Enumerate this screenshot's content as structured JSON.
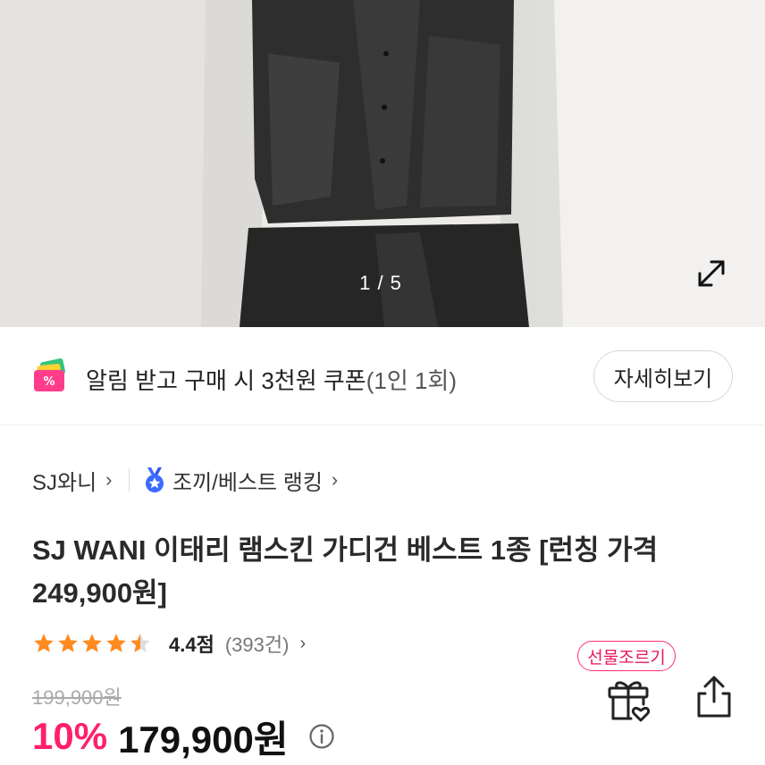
{
  "hero": {
    "counter": "1 / 5",
    "expand_icon": "expand-arrows-icon"
  },
  "coupon": {
    "icon": "coupon-ticket-icon",
    "text_main": "알림 받고 구매 시 3천원 쿠폰",
    "text_sub": "(1인 1회)",
    "detail_label": "자세히보기"
  },
  "breadcrumb": {
    "brand": "SJ와니",
    "ranking_badge_icon": "ranking-medal-icon",
    "ranking": "조끼/베스트 랭킹"
  },
  "product": {
    "title": "SJ WANI 이태리 램스킨 가디건 베스트 1종 [런칭 가격 249,900원]",
    "rating": 4.4,
    "score_label": "4.4점",
    "review_count": "(393건)",
    "original_price": "199,900원",
    "discount": "10%",
    "price": "179,900원"
  },
  "actions": {
    "gift_label": "선물조르기",
    "gift_icon": "gift-heart-icon",
    "share_icon": "share-icon",
    "info_icon": "info-icon"
  },
  "colors": {
    "accent": "#ff1f6b",
    "star": "#ff8a1f"
  }
}
